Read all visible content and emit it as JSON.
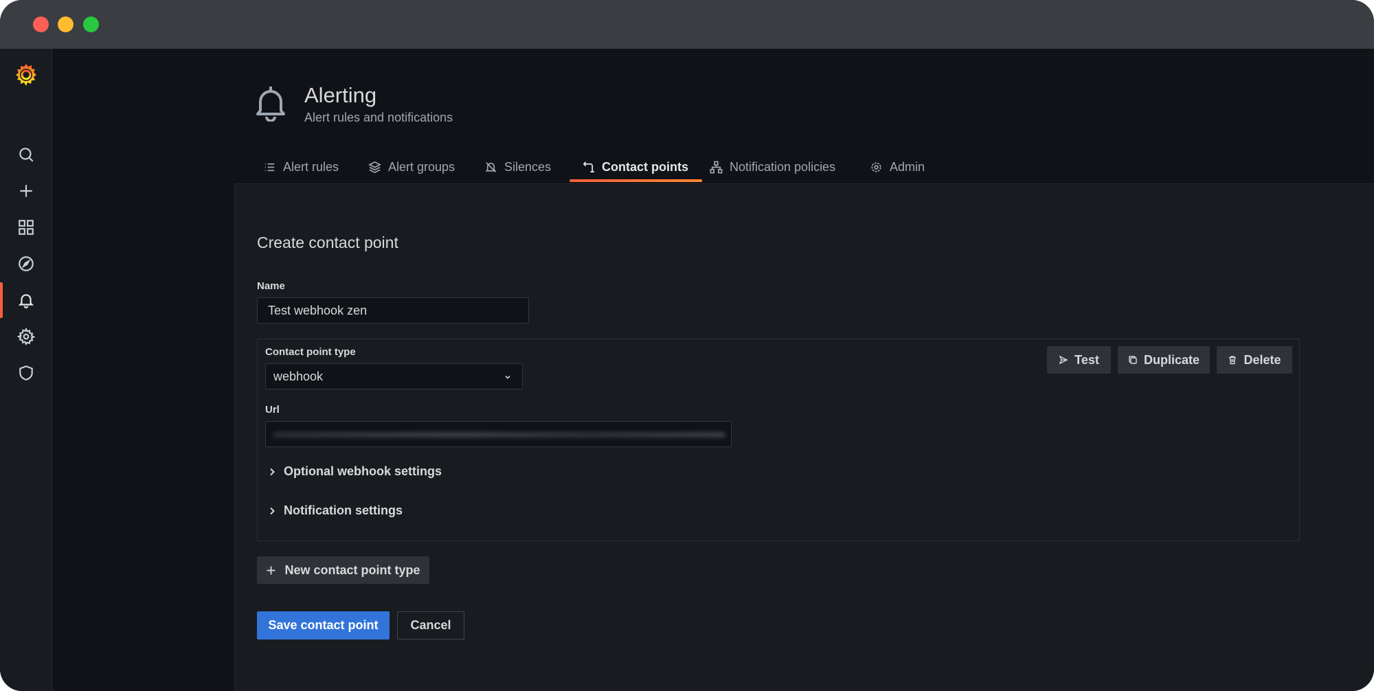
{
  "header": {
    "title": "Alerting",
    "subtitle": "Alert rules and notifications",
    "icon": "bell-icon"
  },
  "tabs": [
    {
      "label": "Alert rules",
      "icon": "list-icon"
    },
    {
      "label": "Alert groups",
      "icon": "layers-icon"
    },
    {
      "label": "Silences",
      "icon": "bell-slash-icon"
    },
    {
      "label": "Contact points",
      "icon": "contact-points-icon",
      "active": true
    },
    {
      "label": "Notification policies",
      "icon": "sitemap-icon"
    },
    {
      "label": "Admin",
      "icon": "cog-icon"
    }
  ],
  "sidebar": {
    "items": [
      {
        "name": "search",
        "icon": "search-icon"
      },
      {
        "name": "create",
        "icon": "plus-icon"
      },
      {
        "name": "dashboards",
        "icon": "apps-icon"
      },
      {
        "name": "explore",
        "icon": "compass-icon"
      },
      {
        "name": "alerting",
        "icon": "bell-icon",
        "active": true
      },
      {
        "name": "configuration",
        "icon": "gear-icon"
      },
      {
        "name": "server-admin",
        "icon": "shield-icon"
      }
    ]
  },
  "form": {
    "title": "Create contact point",
    "name_label": "Name",
    "name_value": "Test webhook zen",
    "type_label": "Contact point type",
    "type_value": "webhook",
    "url_label": "Url",
    "optional_settings": "Optional webhook settings",
    "notification_settings": "Notification settings",
    "test_button": "Test",
    "duplicate_button": "Duplicate",
    "delete_button": "Delete",
    "new_type_button": "New contact point type",
    "save_button": "Save contact point",
    "cancel_button": "Cancel"
  },
  "colors": {
    "accent": "#f55f3e",
    "primary": "#3274d9",
    "background": "#111217",
    "panel": "#181b1f"
  }
}
